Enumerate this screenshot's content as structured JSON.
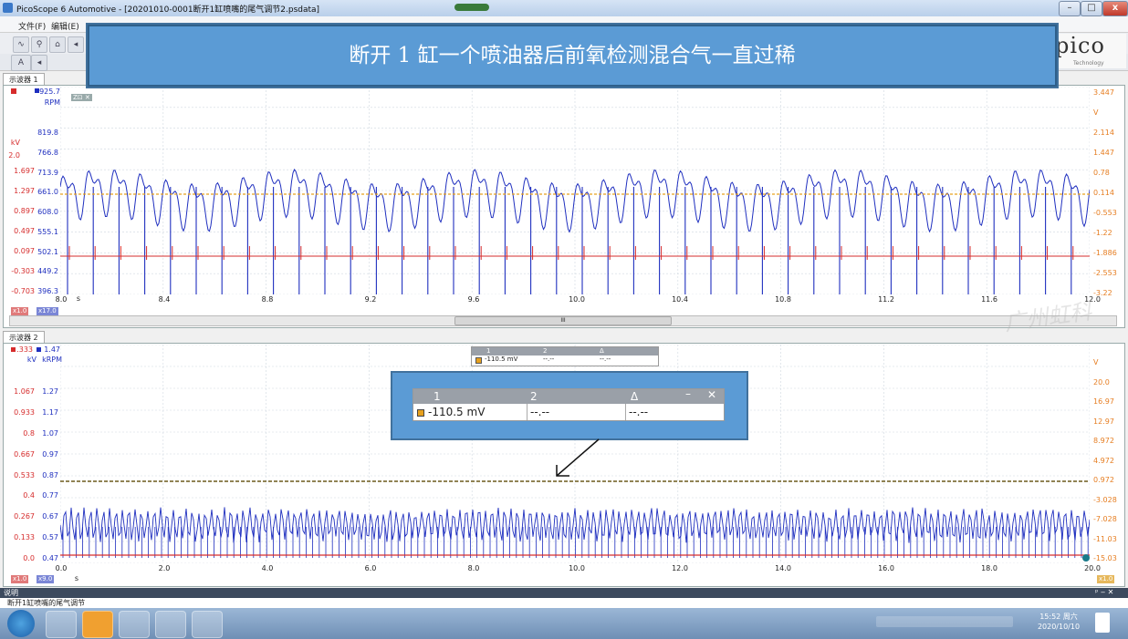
{
  "window": {
    "title": "PicoScope 6 Automotive - [20201010-0001断开1缸喷嘴的尾气调节2.psdata]",
    "minimize": "–",
    "maximize": "□",
    "close": "x"
  },
  "menu": {
    "file": "文件(F)",
    "edit": "编辑(E)"
  },
  "banner": {
    "text": "断开 1 缸一个喷油器后前氧检测混合气一直过稀"
  },
  "logo": {
    "text": "pico",
    "sub": "Technology"
  },
  "toolbar": {
    "zoom_label": "A"
  },
  "scope1": {
    "tab": "示波器 1",
    "top_ch_b": "925.7",
    "unit_b": "RPM",
    "unit_a": "kV",
    "unit_a_val": "2.0",
    "zoom_badge": "Z⊡ ✕",
    "left_a": [
      "1.697",
      "1.297",
      "0.897",
      "0.497",
      "0.097",
      "-0.303",
      "-0.703"
    ],
    "left_b": [
      "819.8",
      "766.8",
      "713.9",
      "661.0",
      "608.0",
      "555.1",
      "502.1",
      "449.2",
      "396.3"
    ],
    "right": [
      "3.447",
      "V",
      "2.114",
      "1.447",
      "0.78",
      "0.114",
      "-0.553",
      "-1.22",
      "-1.886",
      "-2.553",
      "-3.22"
    ],
    "xticks": [
      "8.0",
      "8.4",
      "8.8",
      "9.2",
      "9.6",
      "10.0",
      "10.4",
      "10.8",
      "11.2",
      "11.6",
      "12.0"
    ],
    "xunit": "s",
    "scale_a": "x1.0",
    "scale_b": "x17.0",
    "scroll_mid": "III"
  },
  "scope2": {
    "tab": "示波器 2",
    "top_a": ".333",
    "top_b": "1.47",
    "unit_a": "kV",
    "unit_b": "kRPM",
    "left_a": [
      "1.067",
      "0.933",
      "0.8",
      "0.667",
      "0.533",
      "0.4",
      "0.267",
      "0.133",
      "0.0"
    ],
    "left_b": [
      "1.27",
      "1.17",
      "1.07",
      "0.97",
      "0.87",
      "0.77",
      "0.67",
      "0.57",
      "0.47"
    ],
    "right": [
      "V",
      "20.0",
      "16.97",
      "12.97",
      "8.972",
      "4.972",
      "0.972",
      "-3.028",
      "-7.028",
      "-11.03",
      "-15.03"
    ],
    "xticks": [
      "0.0",
      "2.0",
      "4.0",
      "6.0",
      "8.0",
      "10.0",
      "12.0",
      "14.0",
      "16.0",
      "18.0",
      "20.0"
    ],
    "xunit": "s",
    "scale_a": "x1.0",
    "scale_b": "x9.0",
    "scale_r": "x1.0"
  },
  "measure_small": {
    "h1": "1",
    "h2": "2",
    "h3": "Δ",
    "v1": "-110.5 mV",
    "v2": "--.--",
    "v3": "--.--"
  },
  "measure_big": {
    "h1": "1",
    "h2": "2",
    "h3": "Δ",
    "v1": "-110.5 mV",
    "v2": "--.--",
    "v3": "--.--",
    "min": "–",
    "close": "✕"
  },
  "watermark": "广州虹科",
  "notes": {
    "header": "说明",
    "header_btns": "ᵖ ‒ ✕",
    "text": "断开1缸喷嘴的尾气调节"
  },
  "taskbar": {
    "time": "15:52 周六",
    "date": "2020/10/10"
  },
  "colors": {
    "ch_a": "#d62c2c",
    "ch_b": "#1f2fbf",
    "ch_c": "#e6a01e",
    "banner": "#5b9bd5"
  }
}
